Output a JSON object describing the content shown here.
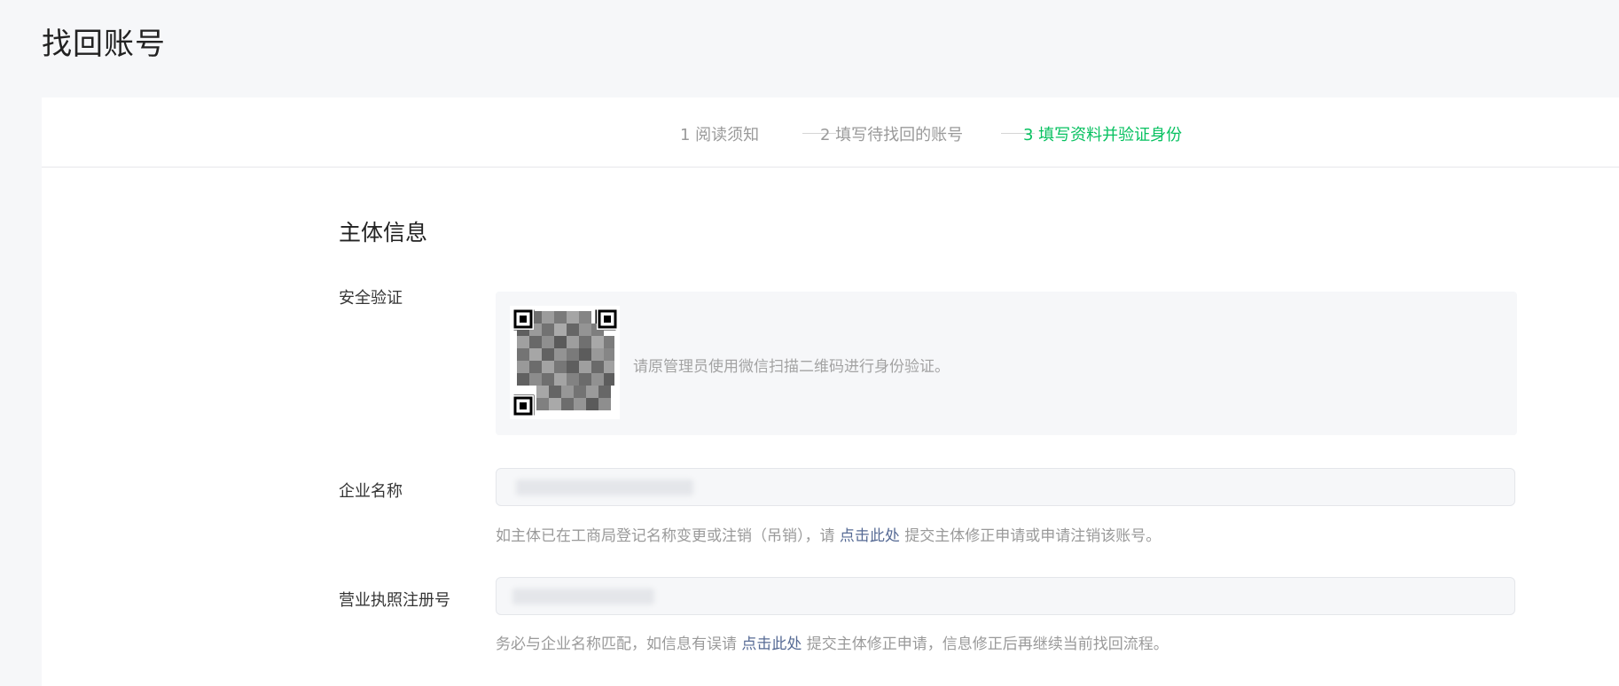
{
  "page": {
    "title": "找回账号"
  },
  "steps": [
    {
      "label": "1 阅读须知",
      "active": false
    },
    {
      "label": "2 填写待找回的账号",
      "active": false
    },
    {
      "label": "3 填写资料并验证身份",
      "active": true
    }
  ],
  "section": {
    "title": "主体信息"
  },
  "security": {
    "label": "安全验证",
    "tip": "请原管理员使用微信扫描二维码进行身份验证。"
  },
  "company": {
    "label": "企业名称",
    "value": "",
    "hint_prefix": "如主体已在工商局登记名称变更或注销（吊销），请 ",
    "hint_link": "点击此处",
    "hint_suffix": " 提交主体修正申请或申请注销该账号。"
  },
  "license": {
    "label": "营业执照注册号",
    "value": "",
    "hint_prefix": "务必与企业名称匹配，如信息有误请 ",
    "hint_link": "点击此处",
    "hint_suffix": " 提交主体修正申请，信息修正后再继续当前找回流程。"
  },
  "colors": {
    "accent": "#07c160",
    "link": "#576b95",
    "muted": "#9a9a9a",
    "background": "#f6f7f9"
  }
}
